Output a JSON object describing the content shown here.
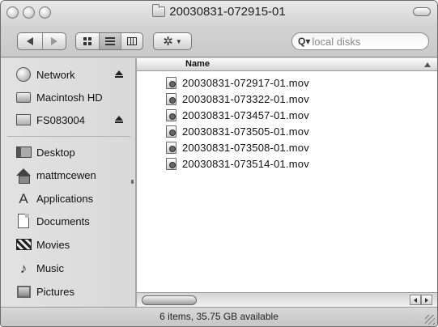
{
  "window": {
    "title": "20030831-072915-01"
  },
  "toolbar": {
    "search_placeholder": "local disks"
  },
  "sidebar": {
    "devices": [
      {
        "label": "Network",
        "icon": "network-globe-icon",
        "eject": true
      },
      {
        "label": "Macintosh HD",
        "icon": "hard-drive-icon",
        "eject": false
      },
      {
        "label": "FS083004",
        "icon": "disk-image-icon",
        "eject": true
      }
    ],
    "places": [
      {
        "label": "Desktop",
        "icon": "desktop-icon"
      },
      {
        "label": "mattmcewen",
        "icon": "home-icon"
      },
      {
        "label": "Applications",
        "icon": "applications-icon"
      },
      {
        "label": "Documents",
        "icon": "documents-icon"
      },
      {
        "label": "Movies",
        "icon": "movies-clapboard-icon"
      },
      {
        "label": "Music",
        "icon": "music-note-icon"
      },
      {
        "label": "Pictures",
        "icon": "pictures-icon"
      }
    ]
  },
  "list": {
    "column_header": "Name",
    "files": [
      "20030831-072917-01.mov",
      "20030831-073322-01.mov",
      "20030831-073457-01.mov",
      "20030831-073505-01.mov",
      "20030831-073508-01.mov",
      "20030831-073514-01.mov"
    ]
  },
  "status": {
    "text": "6 items, 35.75 GB available"
  }
}
